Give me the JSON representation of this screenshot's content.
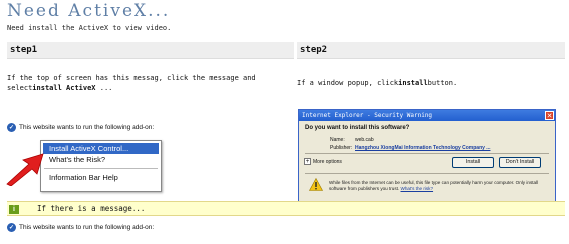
{
  "header": {
    "title": "Need ActiveX...",
    "subtitle": "Need install the ActiveX to view video."
  },
  "step1": {
    "heading": "step1",
    "desc_pre": "If the top of screen has this messag, click the message and select",
    "desc_kw": "install ActiveX",
    "desc_post": " ...",
    "addon_bar_text": "This website wants to run the following add-on:",
    "menu": {
      "items": [
        "Install ActiveX Control...",
        "What's the Risk?",
        "Information Bar Help"
      ]
    }
  },
  "step2": {
    "heading": "step2",
    "desc_pre": "If a window popup, click",
    "desc_kw": "install",
    "desc_post": "button.",
    "dialog": {
      "title": "Internet Explorer - Security Warning",
      "question": "Do you want to install this software?",
      "name_label": "Name:",
      "name_value": "web.cab",
      "publisher_label": "Publisher:",
      "publisher_value": "Hangzhou XiongMai Information Technology Company ...",
      "more_options": "More options",
      "install_button": "Install",
      "dont_install_button": "Don't Install",
      "warning_text": "While files from the Internet can be useful, this file type can potentially harm your computer. Only install software from publishers you trust.",
      "risk_link": "What's the risk?"
    }
  },
  "notice": {
    "badge": "i",
    "text": "If there is a message...",
    "addon_bar_text": "This website wants to run the following add-on:"
  },
  "colors": {
    "title": "#5f7fa6",
    "menu_highlight": "#3168c6",
    "yellow_bar": "#ffffcc",
    "dialog_title": "#235fcf"
  }
}
